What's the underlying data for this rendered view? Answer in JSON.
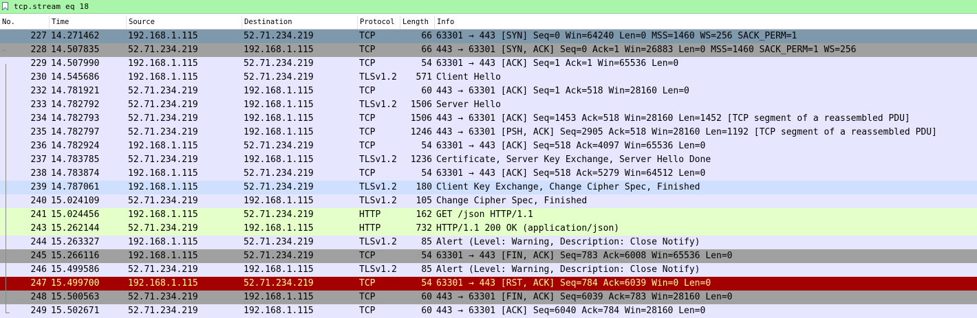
{
  "filter": {
    "text": "tcp.stream eq 18"
  },
  "columns": {
    "no": "No.",
    "time": "Time",
    "source": "Source",
    "destination": "Destination",
    "protocol": "Protocol",
    "length": "Length",
    "info": "Info"
  },
  "colors": {
    "filter_bg": "#a9f5a9",
    "tcp_lilac": "#e7e6ff",
    "tcp_flag_gray": "#a0a0a0",
    "syn_selected": "#7e98ac",
    "http_green": "#e4ffc7",
    "tls_blue": "#cfe0ff",
    "rst_red": "#a40000"
  },
  "rows": [
    {
      "no": "227",
      "time": "14.271462",
      "src": "192.168.1.115",
      "dst": "52.71.234.219",
      "proto": "TCP",
      "len": "66",
      "info": "63301 → 443 [SYN] Seq=0 Win=64240 Len=0 MSS=1460 WS=256 SACK_PERM=1",
      "bg": "#7e98ac",
      "fg": "#000000"
    },
    {
      "no": "228",
      "time": "14.507835",
      "src": "52.71.234.219",
      "dst": "192.168.1.115",
      "proto": "TCP",
      "len": "66",
      "info": "443 → 63301 [SYN, ACK] Seq=0 Ack=1 Win=26883 Len=0 MSS=1460 SACK_PERM=1 WS=256",
      "bg": "#a0a0a0",
      "fg": "#000000"
    },
    {
      "no": "229",
      "time": "14.507990",
      "src": "192.168.1.115",
      "dst": "52.71.234.219",
      "proto": "TCP",
      "len": "54",
      "info": "63301 → 443 [ACK] Seq=1 Ack=1 Win=65536 Len=0",
      "bg": "#e7e6ff",
      "fg": "#000000"
    },
    {
      "no": "230",
      "time": "14.545686",
      "src": "192.168.1.115",
      "dst": "52.71.234.219",
      "proto": "TLSv1.2",
      "len": "571",
      "info": "Client Hello",
      "bg": "#e7e6ff",
      "fg": "#000000"
    },
    {
      "no": "232",
      "time": "14.781921",
      "src": "52.71.234.219",
      "dst": "192.168.1.115",
      "proto": "TCP",
      "len": "60",
      "info": "443 → 63301 [ACK] Seq=1 Ack=518 Win=28160 Len=0",
      "bg": "#e7e6ff",
      "fg": "#000000"
    },
    {
      "no": "233",
      "time": "14.782792",
      "src": "52.71.234.219",
      "dst": "192.168.1.115",
      "proto": "TLSv1.2",
      "len": "1506",
      "info": "Server Hello",
      "bg": "#e7e6ff",
      "fg": "#000000"
    },
    {
      "no": "234",
      "time": "14.782793",
      "src": "52.71.234.219",
      "dst": "192.168.1.115",
      "proto": "TCP",
      "len": "1506",
      "info": "443 → 63301 [ACK] Seq=1453 Ack=518 Win=28160 Len=1452 [TCP segment of a reassembled PDU]",
      "bg": "#e7e6ff",
      "fg": "#000000"
    },
    {
      "no": "235",
      "time": "14.782797",
      "src": "52.71.234.219",
      "dst": "192.168.1.115",
      "proto": "TCP",
      "len": "1246",
      "info": "443 → 63301 [PSH, ACK] Seq=2905 Ack=518 Win=28160 Len=1192 [TCP segment of a reassembled PDU]",
      "bg": "#e7e6ff",
      "fg": "#000000"
    },
    {
      "no": "236",
      "time": "14.782924",
      "src": "192.168.1.115",
      "dst": "52.71.234.219",
      "proto": "TCP",
      "len": "54",
      "info": "63301 → 443 [ACK] Seq=518 Ack=4097 Win=65536 Len=0",
      "bg": "#e7e6ff",
      "fg": "#000000"
    },
    {
      "no": "237",
      "time": "14.783785",
      "src": "52.71.234.219",
      "dst": "192.168.1.115",
      "proto": "TLSv1.2",
      "len": "1236",
      "info": "Certificate, Server Key Exchange, Server Hello Done",
      "bg": "#e7e6ff",
      "fg": "#000000"
    },
    {
      "no": "238",
      "time": "14.783874",
      "src": "192.168.1.115",
      "dst": "52.71.234.219",
      "proto": "TCP",
      "len": "54",
      "info": "63301 → 443 [ACK] Seq=518 Ack=5279 Win=64512 Len=0",
      "bg": "#e7e6ff",
      "fg": "#000000"
    },
    {
      "no": "239",
      "time": "14.787061",
      "src": "192.168.1.115",
      "dst": "52.71.234.219",
      "proto": "TLSv1.2",
      "len": "180",
      "info": "Client Key Exchange, Change Cipher Spec, Finished",
      "bg": "#cfe0ff",
      "fg": "#000000"
    },
    {
      "no": "240",
      "time": "15.024109",
      "src": "52.71.234.219",
      "dst": "192.168.1.115",
      "proto": "TLSv1.2",
      "len": "105",
      "info": "Change Cipher Spec, Finished",
      "bg": "#e7e6ff",
      "fg": "#000000"
    },
    {
      "no": "241",
      "time": "15.024456",
      "src": "192.168.1.115",
      "dst": "52.71.234.219",
      "proto": "HTTP",
      "len": "162",
      "info": "GET /json HTTP/1.1",
      "bg": "#e4ffc7",
      "fg": "#000000"
    },
    {
      "no": "243",
      "time": "15.262144",
      "src": "52.71.234.219",
      "dst": "192.168.1.115",
      "proto": "HTTP",
      "len": "732",
      "info": "HTTP/1.1 200 OK  (application/json)",
      "bg": "#e4ffc7",
      "fg": "#000000"
    },
    {
      "no": "244",
      "time": "15.263327",
      "src": "192.168.1.115",
      "dst": "52.71.234.219",
      "proto": "TLSv1.2",
      "len": "85",
      "info": "Alert (Level: Warning, Description: Close Notify)",
      "bg": "#e7e6ff",
      "fg": "#000000"
    },
    {
      "no": "245",
      "time": "15.266116",
      "src": "192.168.1.115",
      "dst": "52.71.234.219",
      "proto": "TCP",
      "len": "54",
      "info": "63301 → 443 [FIN, ACK] Seq=783 Ack=6008 Win=65536 Len=0",
      "bg": "#a0a0a0",
      "fg": "#000000"
    },
    {
      "no": "246",
      "time": "15.499586",
      "src": "52.71.234.219",
      "dst": "192.168.1.115",
      "proto": "TLSv1.2",
      "len": "85",
      "info": "Alert (Level: Warning, Description: Close Notify)",
      "bg": "#e7e6ff",
      "fg": "#000000"
    },
    {
      "no": "247",
      "time": "15.499700",
      "src": "192.168.1.115",
      "dst": "52.71.234.219",
      "proto": "TCP",
      "len": "54",
      "info": "63301 → 443 [RST, ACK] Seq=784 Ack=6039 Win=0 Len=0",
      "bg": "#a40000",
      "fg": "#fffc9c"
    },
    {
      "no": "248",
      "time": "15.500563",
      "src": "52.71.234.219",
      "dst": "192.168.1.115",
      "proto": "TCP",
      "len": "60",
      "info": "443 → 63301 [FIN, ACK] Seq=6039 Ack=783 Win=28160 Len=0",
      "bg": "#a0a0a0",
      "fg": "#000000"
    },
    {
      "no": "249",
      "time": "15.502671",
      "src": "52.71.234.219",
      "dst": "192.168.1.115",
      "proto": "TCP",
      "len": "60",
      "info": "443 → 63301 [ACK] Seq=6040 Ack=784 Win=28160 Len=0",
      "bg": "#e7e6ff",
      "fg": "#000000"
    }
  ]
}
